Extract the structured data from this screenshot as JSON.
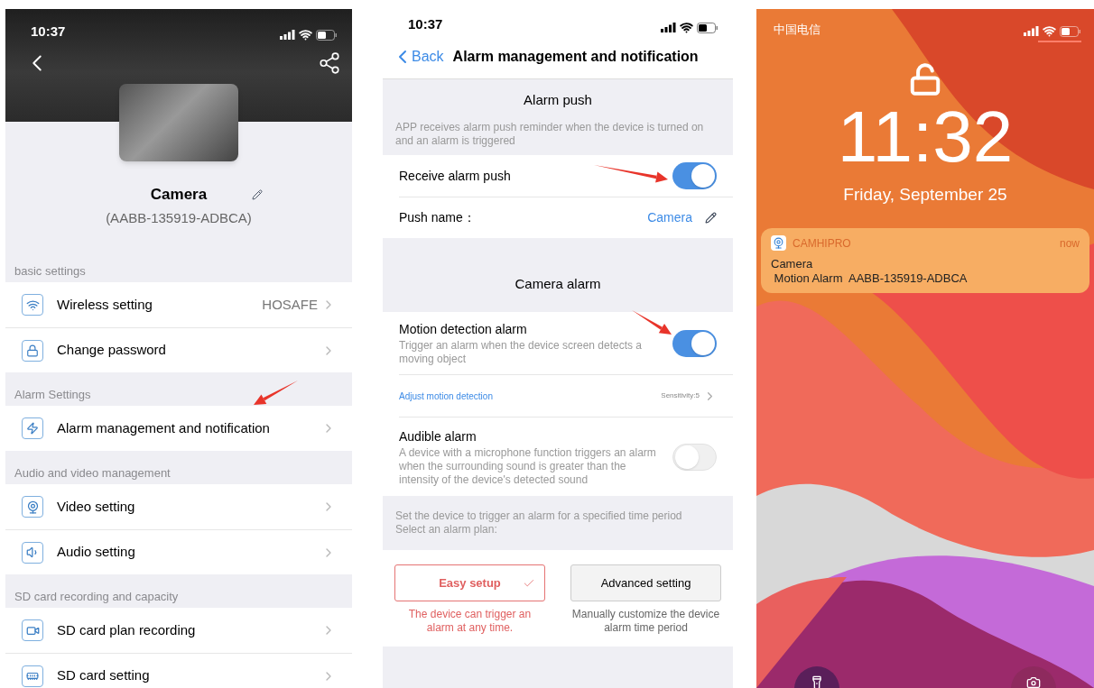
{
  "settings_screen": {
    "status_time": "10:37",
    "device_name": "Camera",
    "device_id": "(AABB-135919-ADBCA)",
    "sections": [
      {
        "title": "basic settings",
        "items": [
          {
            "label": "Wireless setting",
            "value": "HOSAFE"
          },
          {
            "label": "Change password"
          }
        ]
      },
      {
        "title": "Alarm Settings",
        "items": [
          {
            "label": "Alarm management and notification"
          }
        ]
      },
      {
        "title": "Audio and video management",
        "items": [
          {
            "label": "Video setting"
          },
          {
            "label": "Audio setting"
          }
        ]
      },
      {
        "title": "SD card recording and capacity",
        "items": [
          {
            "label": "SD card plan recording"
          },
          {
            "label": "SD card setting"
          }
        ]
      }
    ]
  },
  "alarm_screen": {
    "status_time": "10:37",
    "back_label": "Back",
    "title": "Alarm management and notification",
    "push_heading": "Alarm push",
    "push_description": "APP receives alarm push reminder when the device is turned on and an alarm is triggered",
    "receive_push": {
      "label": "Receive alarm push",
      "on": true
    },
    "push_name": {
      "label": "Push name：",
      "value": "Camera"
    },
    "camera_heading": "Camera alarm",
    "motion_alarm": {
      "label": "Motion detection alarm",
      "description": "Trigger an alarm when the device screen detects a moving object",
      "on": true
    },
    "adjust": {
      "label": "Adjust motion detection",
      "value": "Sensitivity:5"
    },
    "audible_alarm": {
      "label": "Audible alarm",
      "description": "A device with a microphone function triggers an alarm when the surrounding sound is greater than the intensity of the device's detected sound",
      "on": false
    },
    "plan_hint": [
      "Set the device to trigger an alarm for a specified time period",
      "Select an alarm plan:"
    ],
    "plans": [
      {
        "label": "Easy setup",
        "caption": "The device can trigger an alarm at any time.",
        "selected": true
      },
      {
        "label": "Advanced setting",
        "caption": "Manually customize the device alarm time period",
        "selected": false
      }
    ]
  },
  "lock_screen": {
    "carrier": "中国电信",
    "time": "11:32",
    "date": "Friday, September 25",
    "notification": {
      "app": "CAMHIPRO",
      "when": "now",
      "title": "Camera",
      "body": " Motion Alarm  AABB-135919-ADBCA"
    }
  }
}
